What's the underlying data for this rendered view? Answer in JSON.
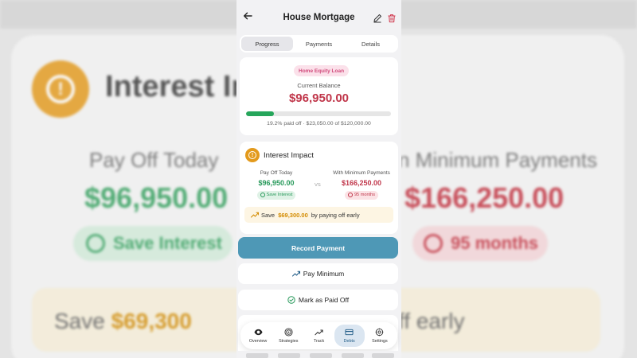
{
  "background": {
    "title": "Interest Im",
    "left_label": "Pay Off Today",
    "right_label": "n Minimum Payments",
    "left_amount": "$96,950.00",
    "right_amount": "$166,250.00",
    "left_pill": "Save Interest",
    "right_pill": "95 months",
    "save_prefix": "Save ",
    "save_amount": "$69,300",
    "save_suffix": "ff early"
  },
  "header": {
    "title": "House Mortgage",
    "back_icon": "arrow-left-icon",
    "edit_icon": "pencil-icon",
    "delete_icon": "trash-icon"
  },
  "tabs": [
    {
      "label": "Progress",
      "active": true
    },
    {
      "label": "Payments",
      "active": false
    },
    {
      "label": "Details",
      "active": false
    }
  ],
  "balance": {
    "badge": "Home Equity Loan",
    "label": "Current Balance",
    "amount": "$96,950.00",
    "progress_percent": 19.2,
    "summary": "19.2% paid off · $23,050.00 of $120,000.00"
  },
  "interest_impact": {
    "title": "Interest Impact",
    "left": {
      "label": "Pay Off Today",
      "amount": "$96,950.00",
      "pill": "Save Interest"
    },
    "vs": "VS",
    "right": {
      "label": "With Minimum Payments",
      "amount": "$166,250.00",
      "pill": "95 months"
    },
    "save_prefix": "Save",
    "save_amount": "$69,300.00",
    "save_suffix": "by paying off early"
  },
  "actions": {
    "record_payment": "Record Payment",
    "pay_minimum": "Pay Minimum",
    "mark_paid_off": "Mark as Paid Off"
  },
  "tabbar": [
    {
      "label": "Overview",
      "icon": "eye-icon",
      "active": false
    },
    {
      "label": "Strategies",
      "icon": "target-icon",
      "active": false
    },
    {
      "label": "Track",
      "icon": "trend-icon",
      "active": false
    },
    {
      "label": "Debts",
      "icon": "card-icon",
      "active": true
    },
    {
      "label": "Settings",
      "icon": "gear-icon",
      "active": false
    }
  ],
  "colors": {
    "primary": "#4e98b6",
    "danger": "#c0364a",
    "success": "#27995a",
    "warning": "#e39a1c"
  }
}
